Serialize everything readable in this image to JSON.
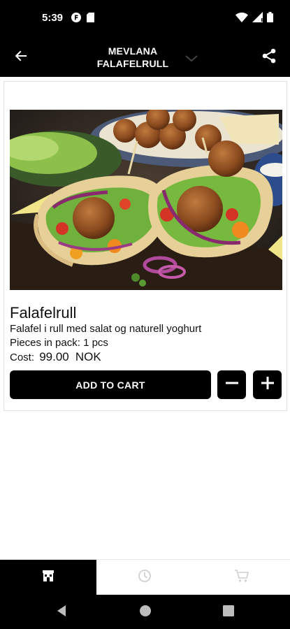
{
  "status_bar": {
    "time": "5:39"
  },
  "header": {
    "title_line1": "MEVLANA",
    "title_line2": "FALAFELRULL"
  },
  "product": {
    "name": "Falafelrull",
    "description": "Falafel i rull med salat og naturell yoghurt",
    "pieces_label": "Pieces in pack:",
    "pieces_value": "1 pcs",
    "cost_label": "Cost:",
    "cost_value": "99.00",
    "cost_currency": "NOK",
    "add_to_cart_label": "ADD TO CART"
  },
  "bottom_nav": {
    "items": [
      {
        "icon": "store-icon",
        "active": true
      },
      {
        "icon": "clock-icon",
        "active": false
      },
      {
        "icon": "cart-icon",
        "active": false
      }
    ]
  },
  "colors": {
    "primary": "#000000",
    "background": "#ffffff",
    "inactive_icon": "#cfcfcf"
  }
}
